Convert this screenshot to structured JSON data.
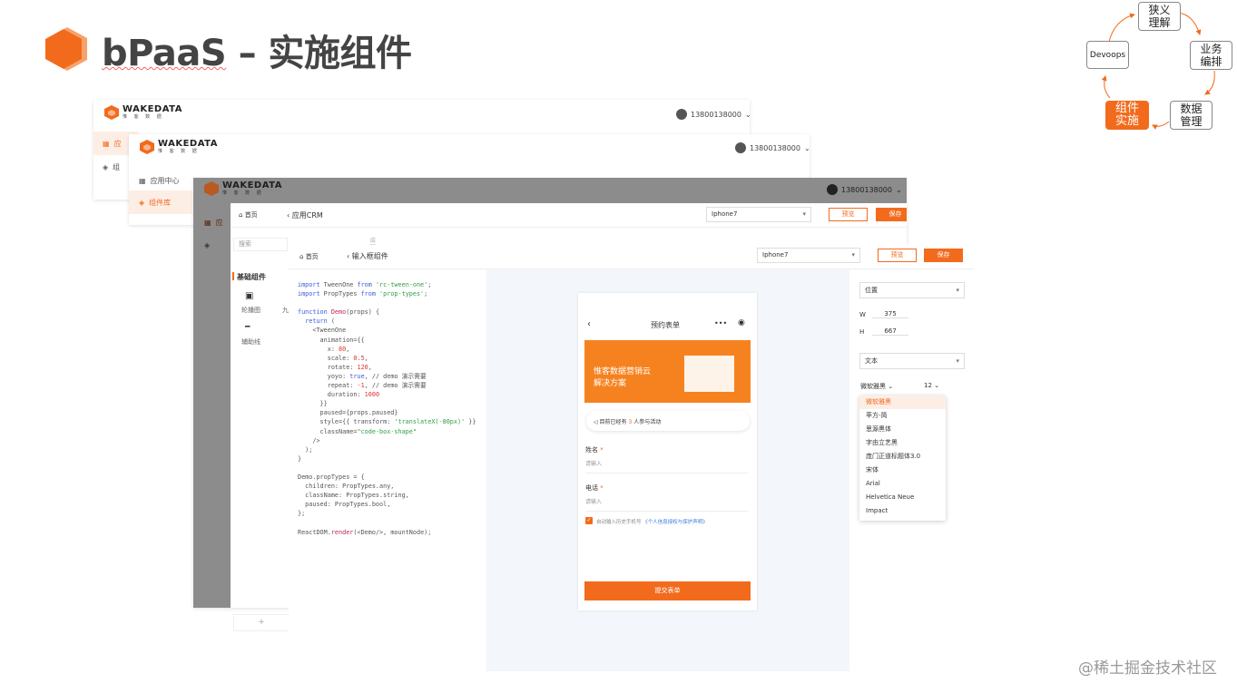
{
  "slide": {
    "title_underlined": "bPaaS",
    "title_rest": " – 实施组件"
  },
  "cycle": {
    "nodes": [
      {
        "lines": [
          "狭义",
          "理解"
        ]
      },
      {
        "lines": [
          "业务",
          "编排"
        ]
      },
      {
        "lines": [
          "数据",
          "管理"
        ]
      },
      {
        "lines": [
          "组件",
          "实施"
        ]
      },
      {
        "lines": [
          "Devoops"
        ]
      }
    ]
  },
  "brand": {
    "name": "WAKEDATA",
    "sub": "惟 客 数 据",
    "accent": "#f26b1d"
  },
  "user": {
    "phone": "13800138000"
  },
  "sidebar": {
    "partial_items": [
      "应",
      "组"
    ],
    "items": [
      "应用中心",
      "组件库"
    ]
  },
  "window3": {
    "home": "首页",
    "breadcrumb": "应用CRM",
    "device": "Iphone7",
    "preview": "预览",
    "save": "保存",
    "search_placeholder": "搜索",
    "tab_partial": "应",
    "extra_tab": "应",
    "group_title": "基础组件",
    "components": [
      "轮播图",
      "辅助线"
    ],
    "component_partial": "九",
    "add_symbol": "+"
  },
  "window4": {
    "home": "首页",
    "breadcrumb": "输入框组件",
    "device": "Iphone7",
    "preview": "预览",
    "save": "保存",
    "code_lines": [
      "import TweenOne from 'rc-tween-one';",
      "import PropTypes from 'prop-types';",
      "",
      "function Demo(props) {",
      "  return (",
      "    <TweenOne",
      "      animation={{",
      "        x: 80,",
      "        scale: 0.5,",
      "        rotate: 120,",
      "        yoyo: true, // demo 演示需要",
      "        repeat: -1, // demo 演示需要",
      "        duration: 1000",
      "      }}",
      "      paused={props.paused}",
      "      style={{ transform: 'translateX(-80px)' }}",
      "      className=\"code-box-shape\"",
      "    />",
      "  );",
      "}",
      "",
      "Demo.propTypes = {",
      "  children: PropTypes.any,",
      "  className: PropTypes.string,",
      "  paused: PropTypes.bool,",
      "};",
      "",
      "ReactDOM.render(<Demo/>, mountNode);"
    ]
  },
  "phone": {
    "title": "预约表单",
    "banner_line1": "惟客数据营销云",
    "banner_line2": "解决方案",
    "participants_prefix": "目前已经有",
    "participants_count": "3",
    "participants_suffix": "人参与活动",
    "name_label": "姓名",
    "name_placeholder": "请输入",
    "phone_label": "电话",
    "phone_placeholder": "请输入",
    "required_mark": "*",
    "consent_text": "自动输入历史手机号",
    "consent_link": "《个人信息授权与保护声明》",
    "submit": "提交表单"
  },
  "props_panel": {
    "position": "位置",
    "w_label": "W",
    "w_value": "375",
    "h_label": "H",
    "h_value": "667",
    "text": "文本",
    "font": "微软雅黑",
    "font_size": "12",
    "font_options": [
      "微软雅黑",
      "苹方-简",
      "思源黑体",
      "字由立艺黑",
      "庞门正道标题体3.0",
      "宋体",
      "Arial",
      "Helvetica Neue",
      "Impact"
    ],
    "font_selected_index": 0
  },
  "watermark": "@稀土掘金技术社区"
}
